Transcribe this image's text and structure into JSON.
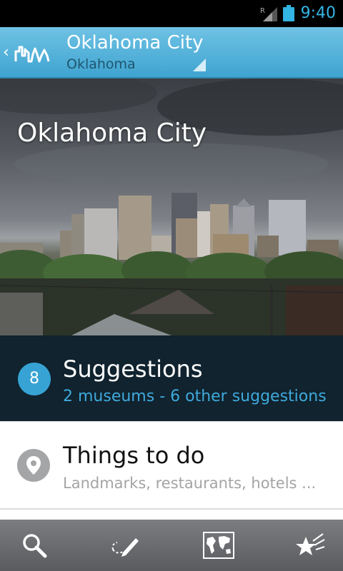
{
  "status_bar": {
    "time": "9:40",
    "roaming_indicator": "R",
    "icons": [
      "signal-icon",
      "battery-icon"
    ]
  },
  "action_bar": {
    "title": "Oklahoma City",
    "subtitle": "Oklahoma",
    "icons": [
      "up-chevron-icon",
      "city-skyline-logo-icon",
      "dropdown-triangle-icon"
    ]
  },
  "hero": {
    "title": "Oklahoma City"
  },
  "suggestions": {
    "count": "8",
    "title": "Suggestions",
    "subtitle": "2 museums - 6 other suggestions"
  },
  "things_to_do": {
    "title": "Things to do",
    "subtitle": "Landmarks, restaurants, hotels ..."
  },
  "bottom_toolbar": {
    "items": [
      "search-icon",
      "notes-pencil-icon",
      "world-map-icon",
      "favorites-stars-icon"
    ]
  },
  "colors": {
    "accent_blue": "#37a3d5",
    "action_bar": "#4aaad5",
    "suggestions_bg": "#10232e",
    "status_time": "#33b5e5"
  }
}
